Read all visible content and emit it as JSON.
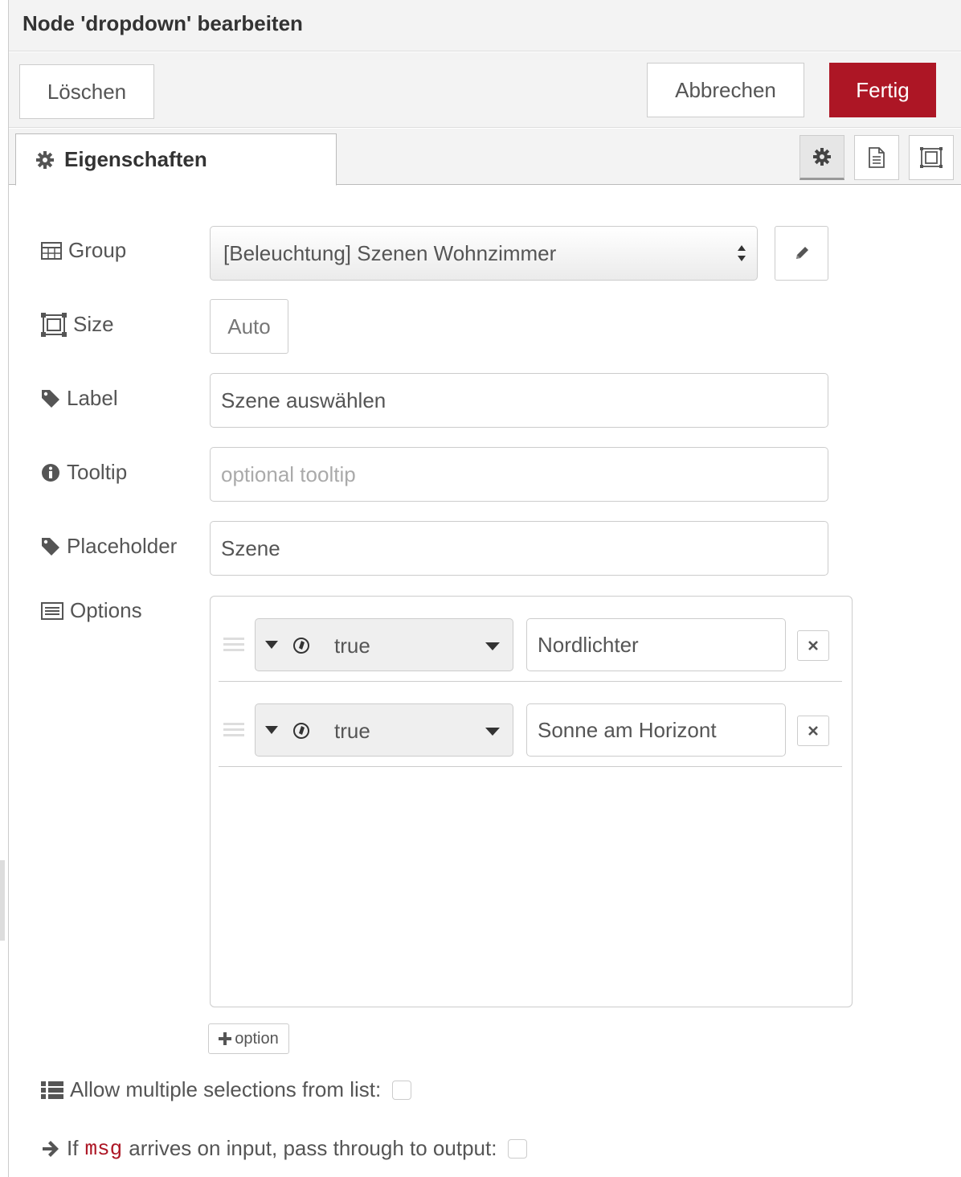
{
  "header": {
    "title": "Node 'dropdown' bearbeiten"
  },
  "toolbar": {
    "delete_label": "Löschen",
    "cancel_label": "Abbrechen",
    "done_label": "Fertig"
  },
  "tabs": {
    "properties_label": "Eigenschaften"
  },
  "colors": {
    "primary": "#ad1625",
    "code": "#ad1625"
  },
  "form": {
    "group": {
      "label": "Group",
      "value": "[Beleuchtung] Szenen Wohnzimmer"
    },
    "size": {
      "label": "Size",
      "value": "Auto"
    },
    "label": {
      "label": "Label",
      "value": "Szene auswählen"
    },
    "tooltip": {
      "label": "Tooltip",
      "placeholder": "optional tooltip"
    },
    "placeholder": {
      "label": "Placeholder",
      "value": "Szene"
    },
    "options": {
      "label": "Options",
      "items": [
        {
          "type": "true",
          "value": "Nordlichter"
        },
        {
          "type": "true",
          "value": "Sonne am Horizont"
        }
      ],
      "add_label": "option"
    },
    "multiple": {
      "label": "Allow multiple selections from list:",
      "checked": false
    },
    "passthrough": {
      "prefix": "If",
      "code": "msg",
      "suffix": "arrives on input, pass through to output:",
      "checked": false
    }
  }
}
